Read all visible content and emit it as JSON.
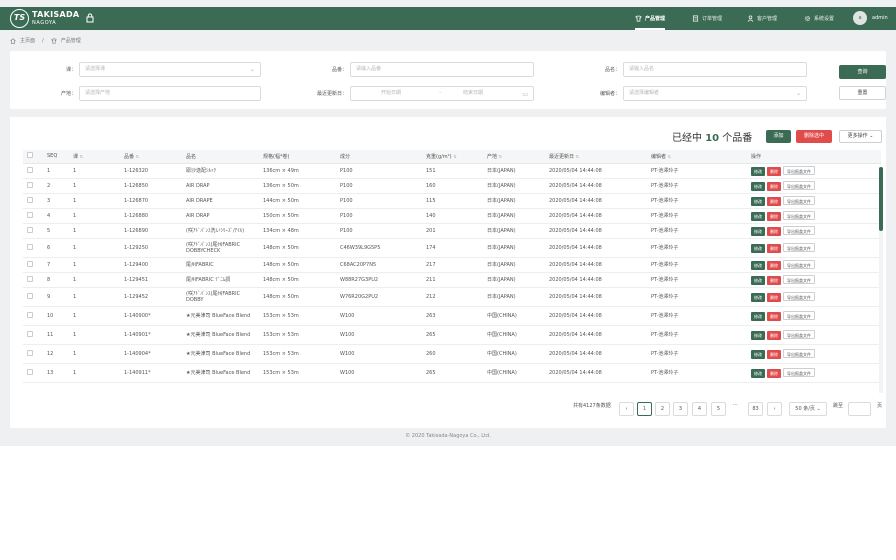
{
  "header": {
    "logo_mark": "TS",
    "brand_name": "TAKISADA",
    "brand_sub": "NAGOYA",
    "nav": [
      {
        "label": "产品管理",
        "icon": "tshirt-icon"
      },
      {
        "label": "订单管理",
        "icon": "order-icon"
      },
      {
        "label": "客户管理",
        "icon": "user-icon"
      },
      {
        "label": "系统设置",
        "icon": "gear-icon"
      }
    ],
    "user": "admin",
    "avatar_text": "a"
  },
  "breadcrumb": {
    "home": "主页面",
    "sep": "/",
    "current": "产品管理"
  },
  "filters": {
    "row1": [
      {
        "label": "课：",
        "placeholder": "请选择课"
      },
      {
        "label": "品番：",
        "placeholder": "请输入品番"
      },
      {
        "label": "品名：",
        "placeholder": "请输入品名"
      }
    ],
    "row2": [
      {
        "label": "产地：",
        "placeholder": "请选择产地"
      },
      {
        "label": "最近更新日：",
        "start": "开始日期",
        "sep": "–",
        "end": "结束日期"
      },
      {
        "label": "编辑者：",
        "placeholder": "请选择编辑者"
      }
    ],
    "search_label": "查询",
    "reset_label": "重置"
  },
  "toolbar": {
    "selected_prefix": "已经中",
    "selected_count": "10",
    "selected_suffix": "个品番",
    "add_label": "添加",
    "delete_selected_label": "删除选中",
    "more_label": "更多操作"
  },
  "table": {
    "columns": [
      "SEQ",
      "课",
      "品番",
      "品名",
      "规格(幅*卷)",
      "成分",
      "克重(g/m²)",
      "产地",
      "最近更新日",
      "编辑者",
      "操作"
    ],
    "actions": {
      "edit": "修改",
      "delete": "删除",
      "export": "导出报盖文件"
    },
    "rows": [
      {
        "seq": "1",
        "ke": "1",
        "code": "1-126320",
        "name": "耶沙逸配ｼﾙｯｸ",
        "spec": "136cm × 49m",
        "comp": "P100",
        "weight": "151",
        "origin": "日本(JAPAN)",
        "date": "2020/05/04 14:44:08",
        "editor": "PT-池澤玲子"
      },
      {
        "seq": "2",
        "ke": "1",
        "code": "1-126850",
        "name": "AIR DRAP",
        "spec": "136cm × 50m",
        "comp": "P100",
        "weight": "160",
        "origin": "日本(JAPAN)",
        "date": "2020/05/04 14:44:08",
        "editor": "PT-池澤玲子"
      },
      {
        "seq": "3",
        "ke": "1",
        "code": "1-126870",
        "name": "AIR DRAPE",
        "spec": "144cm × 50m",
        "comp": "P100",
        "weight": "115",
        "origin": "日本(JAPAN)",
        "date": "2020/05/04 14:44:08",
        "editor": "PT-池澤玲子"
      },
      {
        "seq": "4",
        "ke": "1",
        "code": "1-126880",
        "name": "AIR DRAP",
        "spec": "150cm × 50m",
        "comp": "P100",
        "weight": "140",
        "origin": "日本(JAPAN)",
        "date": "2020/05/04 14:44:08",
        "editor": "PT-池澤玲子"
      },
      {
        "seq": "5",
        "ke": "1",
        "code": "1-126890",
        "name": "(咲ｱﾄﾞﾊﾞﾝｽ洗いｼﾘｰｽﾞ/ｱｲﾙ)",
        "spec": "134cm × 48m",
        "comp": "P100",
        "weight": "201",
        "origin": "日本(JAPAN)",
        "date": "2020/05/04 14:44:08",
        "editor": "PT-池澤玲子"
      },
      {
        "seq": "6",
        "ke": "1",
        "code": "1-129250",
        "name": "(咲ｱﾄﾞﾊﾞﾝｽ)尾州FABRIC DOBBYCHECK",
        "spec": "148cm × 50m",
        "comp": "C46W39L9G5P5",
        "weight": "174",
        "origin": "日本(JAPAN)",
        "date": "2020/05/04 14:44:08",
        "editor": "PT-池澤玲子"
      },
      {
        "seq": "7",
        "ke": "1",
        "code": "1-129400",
        "name": "尾州FABRIC",
        "spec": "148cm × 50m",
        "comp": "C68AC20P7N5",
        "weight": "217",
        "origin": "日本(JAPAN)",
        "date": "2020/05/04 14:44:08",
        "editor": "PT-池澤玲子"
      },
      {
        "seq": "8",
        "ke": "1",
        "code": "1-129451",
        "name": "尾州FABRIC ﾃﾞﾆﾑ調",
        "spec": "148cm × 50m",
        "comp": "W88R27G3PU2",
        "weight": "211",
        "origin": "日本(JAPAN)",
        "date": "2020/05/04 14:44:08",
        "editor": "PT-池澤玲子"
      },
      {
        "seq": "9",
        "ke": "1",
        "code": "1-129452",
        "name": "(咲ｱﾄﾞﾊﾞﾝｽ)尾州FABRIC DOBBY",
        "spec": "148cm × 50m",
        "comp": "W76R20G2PU2",
        "weight": "212",
        "origin": "日本(JAPAN)",
        "date": "2020/05/04 14:44:08",
        "editor": "PT-池澤玲子"
      },
      {
        "seq": "10",
        "ke": "1",
        "code": "1-140900*",
        "name": "★元美津司 BlueFace Blend",
        "spec": "153cm × 53m",
        "comp": "W100",
        "weight": "263",
        "origin": "中国(CHINA)",
        "date": "2020/05/04 14:44:08",
        "editor": "PT-池澤玲子"
      },
      {
        "seq": "11",
        "ke": "1",
        "code": "1-140901*",
        "name": "★元美津司 BlueFace Blend",
        "spec": "153cm × 53m",
        "comp": "W100",
        "weight": "265",
        "origin": "中国(CHINA)",
        "date": "2020/05/04 14:44:08",
        "editor": "PT-池澤玲子"
      },
      {
        "seq": "12",
        "ke": "1",
        "code": "1-140904*",
        "name": "★元美津司 BlueFace Blend",
        "spec": "153cm × 53m",
        "comp": "W100",
        "weight": "260",
        "origin": "中国(CHINA)",
        "date": "2020/05/04 14:44:08",
        "editor": "PT-池澤玲子"
      },
      {
        "seq": "13",
        "ke": "1",
        "code": "1-140911*",
        "name": "★元美津司 BlueFace Blend",
        "spec": "153cm × 53m",
        "comp": "W100",
        "weight": "265",
        "origin": "中国(CHINA)",
        "date": "2020/05/04 14:44:08",
        "editor": "PT-池澤玲子"
      }
    ]
  },
  "pagination": {
    "total_text": "共有4127条数据",
    "pages": [
      "1",
      "2",
      "3",
      "4",
      "5"
    ],
    "ellipsis": "···",
    "last": "83",
    "page_size": "50 条/页",
    "goto_label": "跳至",
    "goto_suffix": "页"
  },
  "footer": {
    "copyright": "© 2020 Takisada-Nagoya Co., Ltd."
  },
  "colors": {
    "brand": "#3c6b55",
    "danger": "#e04b4b",
    "background": "#eef0f2"
  }
}
